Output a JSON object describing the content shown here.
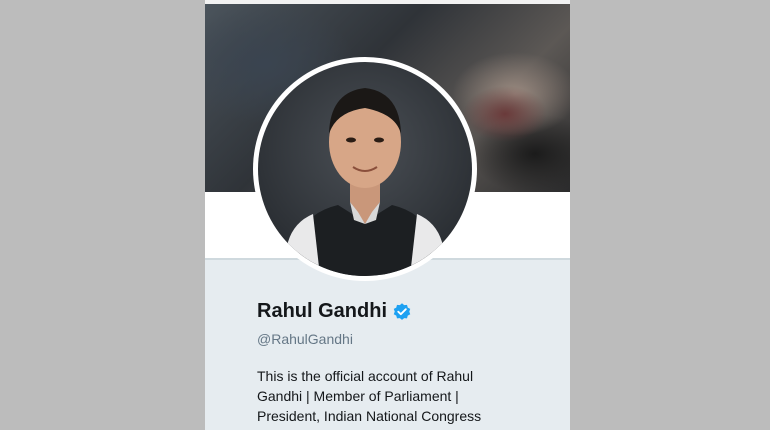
{
  "profile": {
    "name": "Rahul Gandhi",
    "handle": "@RahulGandhi",
    "bio_lines": [
      "This is the official account of Rahul",
      "Gandhi | Member of Parliament |",
      "President, Indian National Congress"
    ]
  },
  "icons": {
    "verified": "verified-badge-icon"
  },
  "colors": {
    "verified_blue": "#1da1f2",
    "name_text": "#14171a",
    "handle_text": "#657786",
    "card_background": "#e6ecf0"
  }
}
